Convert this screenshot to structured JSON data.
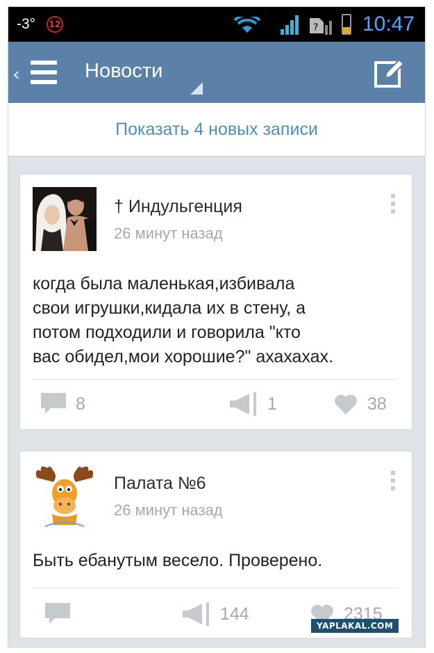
{
  "status_bar": {
    "temperature": "-3°",
    "notification_count": "12",
    "time": "10:47"
  },
  "header": {
    "title": "Новости"
  },
  "feed": {
    "show_new_label": "Показать 4 новых записи",
    "posts": [
      {
        "author": "† Индульгенция",
        "time_ago": "26 минут назад",
        "text_lines": [
          "когда была маленькая,избивала",
          "свои игрушки,кидала их в стену, а",
          "потом подходили и говорила \"кто",
          "вас обидел,мои хорошие?\" ахахахах."
        ],
        "comments": "8",
        "reposts": "1",
        "likes": "38"
      },
      {
        "author": "Палата №6",
        "time_ago": "26 минут назад",
        "text_lines": [
          "Быть ебанутым весело. Проверено."
        ],
        "comments": "",
        "reposts": "144",
        "likes": "2315"
      }
    ]
  },
  "watermark": "YAPLAKAL.COM",
  "colors": {
    "header_bg": "#5b81a8",
    "link_blue": "#4b8fc2",
    "time_blue": "#4fa6ff"
  }
}
